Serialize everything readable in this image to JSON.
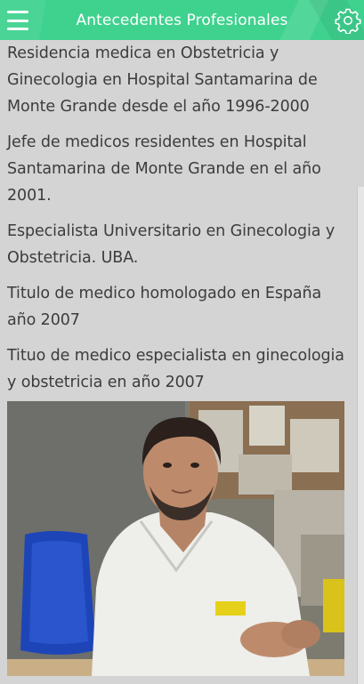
{
  "header": {
    "title": "Antecedentes Profesionales",
    "menu_icon": "hamburger-menu-icon",
    "settings_icon": "gear-icon",
    "accent_color": "#3fd28f"
  },
  "content": {
    "paragraphs": [
      "Residencia medica en Obstetricia y Ginecologia en Hospital Santamarina de Monte Grande desde el año 1996-2000",
      "Jefe de medicos residentes en Hospital Santamarina de Monte Grande en el año 2001.",
      "Especialista Universitario en Ginecologia y Obstetricia. UBA.",
      "Titulo de medico homologado en España año 2007",
      "Tituo de medico especialista en ginecologia y obstetricia en año 2007"
    ],
    "photo": "doctor-portrait-photo"
  }
}
